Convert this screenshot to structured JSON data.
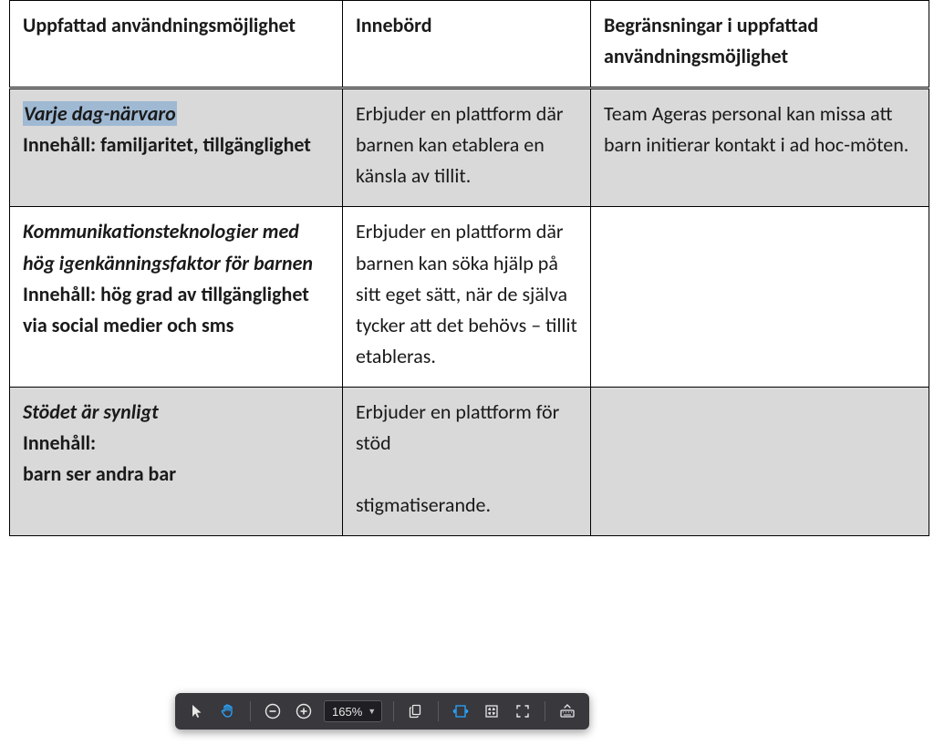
{
  "table": {
    "headers": {
      "col1": "Uppfattad användningsmöjlighet",
      "col2": "Innebörd",
      "col3": "Begränsningar i uppfattad användningsmöjlighet"
    },
    "rows": [
      {
        "shaded": true,
        "title": "Varje dag-närvaro",
        "content_label": "Innehåll: familjaritet, tillgänglighet",
        "meaning": "Erbjuder en plattform där barnen kan etablera en känsla av tillit.",
        "limits": "Team Ageras personal kan missa att barn initierar kontakt i ad hoc-möten.",
        "title_highlighted": true
      },
      {
        "shaded": false,
        "title": "Kommunikationsteknologier med hög igenkänningsfaktor för barnen",
        "content_label": "Innehåll: hög grad av tillgänglighet via social medier och sms",
        "meaning": "Erbjuder en plattform där barnen kan söka hjälp på sitt eget sätt, när de själva tycker att det behövs – tillit etableras.",
        "limits": ""
      },
      {
        "shaded": true,
        "title": "Stödet är synligt",
        "content_label_line1": "Innehåll:",
        "content_label_line2": "barn ser andra bar",
        "meaning": "Erbjuder en plattform för stöd",
        "meaning_cut": "stigmatiserande.",
        "limits": ""
      }
    ]
  },
  "toolbar": {
    "zoom_value": "165%",
    "icons": {
      "select": "select-arrow-icon",
      "pan": "hand-pan-icon",
      "zoom_out": "zoom-out-icon",
      "zoom_in": "zoom-in-icon",
      "dropdown": "caret-down-icon",
      "copy": "copy-pages-icon",
      "fit_width": "fit-width-icon",
      "fit_page": "fit-page-icon",
      "fullscreen": "fullscreen-icon",
      "keyboard": "keyboard-up-icon"
    }
  }
}
